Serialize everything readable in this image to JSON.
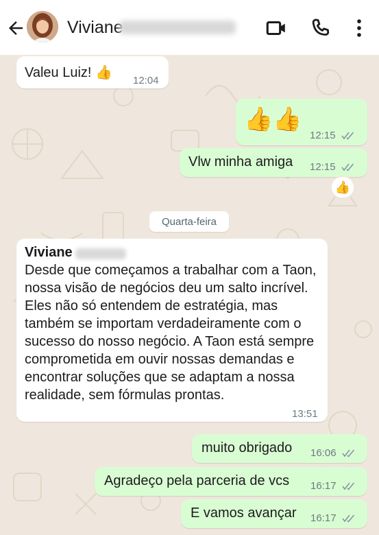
{
  "header": {
    "contact_name": "Viviane",
    "back_icon": "arrow-left-icon",
    "video_icon": "video-camera-icon",
    "call_icon": "phone-icon",
    "menu_icon": "more-vertical-icon"
  },
  "messages": [
    {
      "direction": "incoming",
      "text": "Valeu Luiz! 👍",
      "time": "12:04"
    },
    {
      "direction": "outgoing",
      "text": "👍👍",
      "time": "12:15",
      "status": "read"
    },
    {
      "direction": "outgoing",
      "text": "Vlw minha amiga",
      "time": "12:15",
      "status": "read",
      "reaction": "👍"
    },
    {
      "direction": "incoming",
      "sender": "Viviane",
      "text": "Desde que começamos a trabalhar com a Taon, nossa visão de negócios deu um salto incrível. Eles não só entendem de estratégia, mas também se importam verdadeiramente com o sucesso do nosso negócio. A Taon está sempre comprometida em ouvir nossas demandas e encontrar soluções que se adaptam a nossa realidade, sem fórmulas prontas.",
      "time": "13:51"
    },
    {
      "direction": "outgoing",
      "text": "muito obrigado",
      "time": "16:06",
      "status": "read"
    },
    {
      "direction": "outgoing",
      "text": "Agradeço pela parceria de vcs",
      "time": "16:17",
      "status": "read"
    },
    {
      "direction": "outgoing",
      "text": "E vamos avançar",
      "time": "16:17",
      "status": "read"
    }
  ],
  "date_separator": "Quarta-feira",
  "colors": {
    "incoming_bubble": "#ffffff",
    "outgoing_bubble": "#d9fdd3",
    "read_ticks": "#8696a0",
    "chat_background": "#efe7dd"
  }
}
